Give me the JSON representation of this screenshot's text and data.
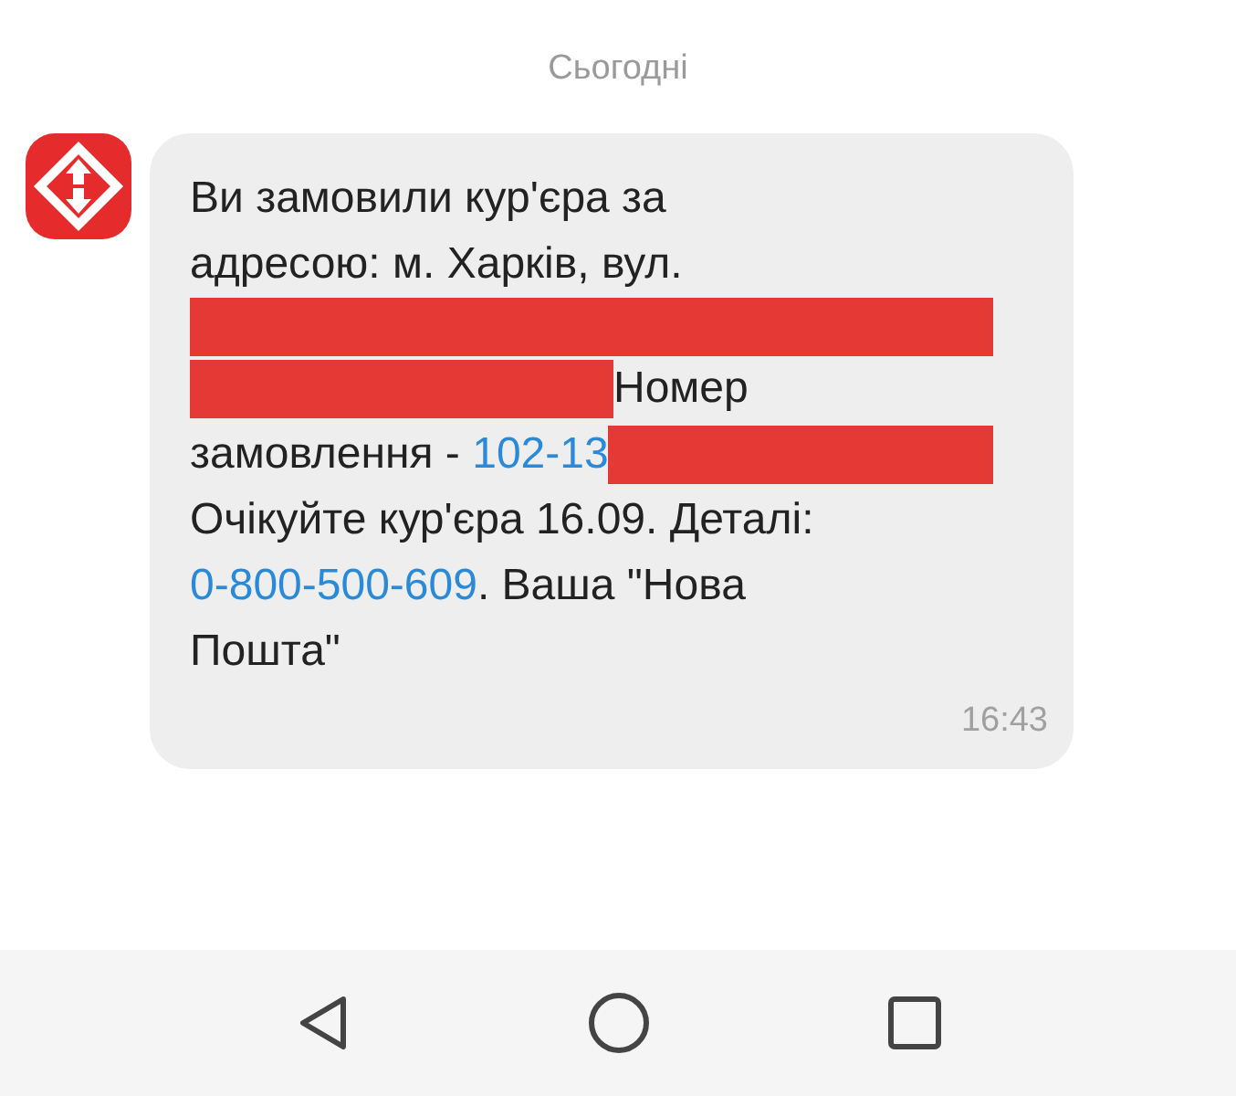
{
  "date_label": "Сьогодні",
  "message": {
    "lines": [
      [
        {
          "kind": "text",
          "text": "Ви замовили кур'єра за"
        }
      ],
      [
        {
          "kind": "text",
          "text": "адресою: м. Харків, вул."
        }
      ],
      [
        {
          "kind": "redaction"
        }
      ],
      [
        {
          "kind": "redaction"
        },
        {
          "kind": "text",
          "text": "Номер"
        }
      ],
      [
        {
          "kind": "text",
          "text": "замовлення - "
        },
        {
          "kind": "link",
          "text": "102-13"
        },
        {
          "kind": "redaction"
        }
      ],
      [
        {
          "kind": "text",
          "text": "Очікуйте кур'єра 16.09. Деталі:"
        }
      ],
      [
        {
          "kind": "link",
          "text": "0-800-500-609"
        },
        {
          "kind": "text",
          "text": ". Ваша \"Нова"
        }
      ],
      [
        {
          "kind": "text",
          "text": "Пошта\""
        }
      ]
    ],
    "time": "16:43"
  }
}
